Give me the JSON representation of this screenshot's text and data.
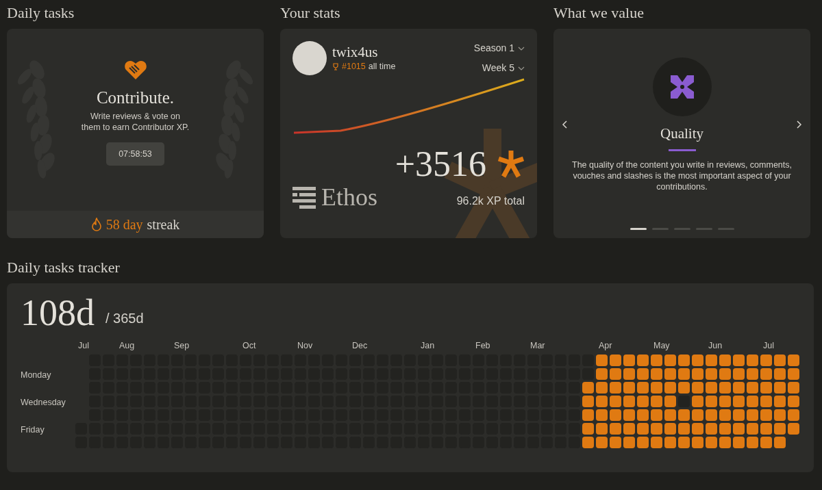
{
  "daily_tasks": {
    "heading": "Daily tasks",
    "title": "Contribute.",
    "description": "Write reviews & vote on them to earn Contributor XP.",
    "timer": "07:58:53",
    "streak_count": "58 day",
    "streak_label": "streak"
  },
  "stats": {
    "heading": "Your stats",
    "username": "twix4us",
    "rank": "#1015",
    "rank_suffix": "all time",
    "season": "Season 1",
    "week": "Week 5",
    "brand": "Ethos",
    "xp_gain": "+3516",
    "xp_total": "96.2k XP total"
  },
  "values": {
    "heading": "What we value",
    "title": "Quality",
    "description": "The quality of the content you write in reviews, comments, vouches and slashes is the most important aspect of your contributions.",
    "slides": [
      {
        "selected": true
      },
      {
        "selected": false
      },
      {
        "selected": false
      },
      {
        "selected": false
      },
      {
        "selected": false
      }
    ]
  },
  "tracker": {
    "heading": "Daily tasks tracker",
    "days_done": "108d",
    "days_total": "/ 365d",
    "day_labels": [
      "Monday",
      "Wednesday",
      "Friday"
    ],
    "weeks": [
      {
        "month": "Jul",
        "days": [
          false,
          false
        ]
      },
      {
        "days": [
          false,
          false,
          false,
          false,
          false,
          false,
          false
        ]
      },
      {
        "days": [
          false,
          false,
          false,
          false,
          false,
          false,
          false
        ]
      },
      {
        "month": "Aug",
        "days": [
          false,
          false,
          false,
          false,
          false,
          false,
          false
        ]
      },
      {
        "days": [
          false,
          false,
          false,
          false,
          false,
          false,
          false
        ]
      },
      {
        "days": [
          false,
          false,
          false,
          false,
          false,
          false,
          false
        ]
      },
      {
        "days": [
          false,
          false,
          false,
          false,
          false,
          false,
          false
        ]
      },
      {
        "month": "Sep",
        "days": [
          false,
          false,
          false,
          false,
          false,
          false,
          false
        ]
      },
      {
        "days": [
          false,
          false,
          false,
          false,
          false,
          false,
          false
        ]
      },
      {
        "days": [
          false,
          false,
          false,
          false,
          false,
          false,
          false
        ]
      },
      {
        "days": [
          false,
          false,
          false,
          false,
          false,
          false,
          false
        ]
      },
      {
        "days": [
          false,
          false,
          false,
          false,
          false,
          false,
          false
        ]
      },
      {
        "month": "Oct",
        "days": [
          false,
          false,
          false,
          false,
          false,
          false,
          false
        ]
      },
      {
        "days": [
          false,
          false,
          false,
          false,
          false,
          false,
          false
        ]
      },
      {
        "days": [
          false,
          false,
          false,
          false,
          false,
          false,
          false
        ]
      },
      {
        "days": [
          false,
          false,
          false,
          false,
          false,
          false,
          false
        ]
      },
      {
        "month": "Nov",
        "days": [
          false,
          false,
          false,
          false,
          false,
          false,
          false
        ]
      },
      {
        "days": [
          false,
          false,
          false,
          false,
          false,
          false,
          false
        ]
      },
      {
        "days": [
          false,
          false,
          false,
          false,
          false,
          false,
          false
        ]
      },
      {
        "days": [
          false,
          false,
          false,
          false,
          false,
          false,
          false
        ]
      },
      {
        "month": "Dec",
        "days": [
          false,
          false,
          false,
          false,
          false,
          false,
          false
        ]
      },
      {
        "days": [
          false,
          false,
          false,
          false,
          false,
          false,
          false
        ]
      },
      {
        "days": [
          false,
          false,
          false,
          false,
          false,
          false,
          false
        ]
      },
      {
        "days": [
          false,
          false,
          false,
          false,
          false,
          false,
          false
        ]
      },
      {
        "days": [
          false,
          false,
          false,
          false,
          false,
          false,
          false
        ]
      },
      {
        "month": "Jan",
        "days": [
          false,
          false,
          false,
          false,
          false,
          false,
          false
        ]
      },
      {
        "days": [
          false,
          false,
          false,
          false,
          false,
          false,
          false
        ]
      },
      {
        "days": [
          false,
          false,
          false,
          false,
          false,
          false,
          false
        ]
      },
      {
        "days": [
          false,
          false,
          false,
          false,
          false,
          false,
          false
        ]
      },
      {
        "month": "Feb",
        "days": [
          false,
          false,
          false,
          false,
          false,
          false,
          false
        ]
      },
      {
        "days": [
          false,
          false,
          false,
          false,
          false,
          false,
          false
        ]
      },
      {
        "days": [
          false,
          false,
          false,
          false,
          false,
          false,
          false
        ]
      },
      {
        "days": [
          false,
          false,
          false,
          false,
          false,
          false,
          false
        ]
      },
      {
        "month": "Mar",
        "days": [
          false,
          false,
          false,
          false,
          false,
          false,
          false
        ]
      },
      {
        "days": [
          false,
          false,
          false,
          false,
          false,
          false,
          false
        ]
      },
      {
        "days": [
          false,
          false,
          false,
          false,
          false,
          false,
          false
        ]
      },
      {
        "days": [
          false,
          false,
          false,
          false,
          false,
          false,
          false
        ]
      },
      {
        "days": [
          false,
          false,
          true,
          true,
          true,
          true,
          true
        ]
      },
      {
        "month": "Apr",
        "days": [
          true,
          true,
          true,
          true,
          true,
          true,
          true
        ]
      },
      {
        "days": [
          true,
          true,
          true,
          true,
          true,
          true,
          true
        ]
      },
      {
        "days": [
          true,
          true,
          true,
          true,
          true,
          true,
          true
        ]
      },
      {
        "days": [
          true,
          true,
          true,
          true,
          true,
          true,
          true
        ]
      },
      {
        "month": "May",
        "days": [
          true,
          true,
          true,
          true,
          true,
          true,
          true
        ]
      },
      {
        "days": [
          true,
          true,
          true,
          true,
          true,
          true,
          true
        ]
      },
      {
        "days": [
          true,
          true,
          true,
          false,
          true,
          true,
          true
        ]
      },
      {
        "days": [
          true,
          true,
          true,
          true,
          true,
          true,
          true
        ]
      },
      {
        "month": "Jun",
        "days": [
          true,
          true,
          true,
          true,
          true,
          true,
          true
        ]
      },
      {
        "days": [
          true,
          true,
          true,
          true,
          true,
          true,
          true
        ]
      },
      {
        "days": [
          true,
          true,
          true,
          true,
          true,
          true,
          true
        ]
      },
      {
        "days": [
          true,
          true,
          true,
          true,
          true,
          true,
          true
        ]
      },
      {
        "month": "Jul",
        "days": [
          true,
          true,
          true,
          true,
          true,
          true,
          true
        ]
      },
      {
        "days": [
          true,
          true,
          true,
          true,
          true,
          true,
          true
        ]
      },
      {
        "days": [
          true,
          true,
          true,
          true,
          true,
          true
        ]
      }
    ]
  }
}
